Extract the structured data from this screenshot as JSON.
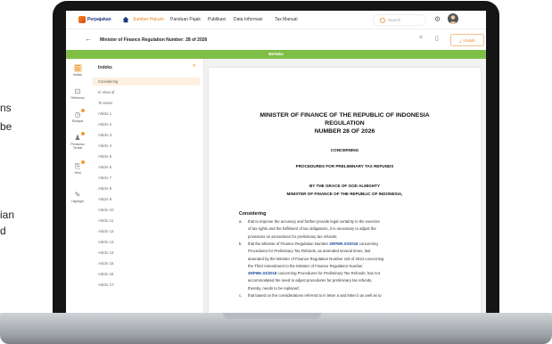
{
  "side_text": {
    "line1": "ns",
    "line2": "be",
    "line3": "ian",
    "line4": "d"
  },
  "topnav": {
    "logo": "Perpajakan",
    "items": [
      "Sumber Hukum",
      "Panduan Pajak",
      "Publikasi",
      "Data Informasi",
      "Tax Manual"
    ],
    "search_placeholder": "Search",
    "settings_icon": "gear-icon"
  },
  "titlebar": {
    "title": "Minister of Finance Regulation Number: 28 of 2026",
    "download_label": "Unduh"
  },
  "banner": "Berlaku",
  "rail": [
    {
      "label": "Indeks",
      "icon": "list-icon"
    },
    {
      "label": "Referensi",
      "icon": "book-icon"
    },
    {
      "label": "Riwayat",
      "icon": "history-icon"
    },
    {
      "label": "Peraturan Terkait",
      "icon": "people-icon"
    },
    {
      "label": "Versi",
      "icon": "versions-icon"
    },
    {
      "label": "Highlight",
      "icon": "highlight-icon"
    }
  ],
  "indeks": {
    "title": "Indeks",
    "items": [
      "Considering",
      "In View of",
      "To enact",
      "Article 1",
      "Article 2",
      "Article 3",
      "Article 4",
      "Article 5",
      "Article 6",
      "Article 7",
      "Article 8",
      "Article 9",
      "Article 10",
      "Article 11",
      "Article 12",
      "Article 13",
      "Article 14",
      "Article 15",
      "Article 16",
      "Article 17"
    ]
  },
  "document": {
    "title1": "MINISTER OF FINANCE OF THE REPUBLIC OF INDONESIA",
    "title2": "REGULATION",
    "title3": "NUMBER 28 OF 2026",
    "concerning": "CONCERNING",
    "subject": "PROCEDURES FOR PRELIMINARY TAX REFUNDS",
    "grace": "BY THE GRACE OF GOD ALMIGHTY",
    "minister": "MINISTER OF FINANCE OF THE REPUBLIC OF INDONESIA,",
    "considering": "Considering",
    "lines": [
      {
        "lbl": "a.",
        "pre": "that to improve the accuracy and further provide legal certainty in the exercise",
        "link": "",
        "post": ""
      },
      {
        "lbl": "",
        "pre": "of tax rights and the fulfilment of tax obligations, it is necessary to adjust the",
        "link": "",
        "post": ""
      },
      {
        "lbl": "",
        "pre": "provisions on procedures for preliminary tax refunds;",
        "link": "",
        "post": ""
      },
      {
        "lbl": "b.",
        "pre": "that the Minister of Finance Regulation Number ",
        "link": "39/PMK.03/2018",
        "post": " concerning"
      },
      {
        "lbl": "",
        "pre": "Procedures for Preliminary Tax Refunds, as amended several times, last",
        "link": "",
        "post": ""
      },
      {
        "lbl": "",
        "pre": "amended by the Minister of Finance Regulation Number 119 of 2024 concerning",
        "link": "",
        "post": ""
      },
      {
        "lbl": "",
        "pre": "the Third Amendment to the Minister of Finance Regulation Number",
        "link": "",
        "post": ""
      },
      {
        "lbl": "",
        "pre": "",
        "link": "39/PMK.03/2018",
        "post": " concerning Procedures for Preliminary Tax Refunds, has not"
      },
      {
        "lbl": "",
        "pre": "accommodated the need to adjust procedures for preliminary tax refunds,",
        "link": "",
        "post": ""
      },
      {
        "lbl": "",
        "pre": "thereby, needs to be replaced;",
        "link": "",
        "post": ""
      },
      {
        "lbl": "c.",
        "pre": "that based on the considerations referred to in letter a and letter b as well as to",
        "link": "",
        "post": ""
      }
    ]
  }
}
